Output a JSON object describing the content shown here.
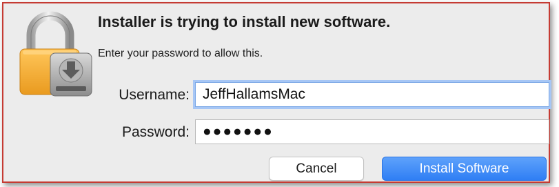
{
  "dialog": {
    "title": "Installer is trying to install new software.",
    "subtitle": "Enter your password to allow this.",
    "icon": "installer-lock-icon"
  },
  "form": {
    "username_label": "Username:",
    "username_value": "JeffHallamsMac",
    "password_label": "Password:",
    "password_value": "●●●●●●●"
  },
  "buttons": {
    "cancel_label": "Cancel",
    "install_label": "Install Software"
  },
  "colors": {
    "accent": "#2f7ef4",
    "dialog_background": "#ececec",
    "border_highlight": "#c53b33"
  }
}
